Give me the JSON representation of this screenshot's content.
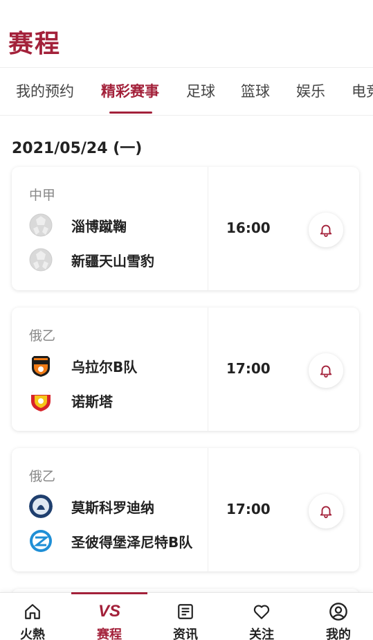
{
  "header": {
    "title": "赛程"
  },
  "tabs": [
    {
      "label": "我的预约"
    },
    {
      "label": "精彩赛事"
    },
    {
      "label": "足球"
    },
    {
      "label": "篮球"
    },
    {
      "label": "娱乐"
    },
    {
      "label": "电竞"
    }
  ],
  "active_tab": "精彩赛事",
  "date": "2021/05/24 (一)",
  "matches": [
    {
      "league": "中甲",
      "home": "淄博蹴鞠",
      "away": "新疆天山雪豹",
      "time": "16:00"
    },
    {
      "league": "俄乙",
      "home": "乌拉尔B队",
      "away": "诺斯塔",
      "time": "17:00"
    },
    {
      "league": "俄乙",
      "home": "莫斯科罗迪纳",
      "away": "圣彼得堡泽尼特B队",
      "time": "17:00"
    }
  ],
  "nav": [
    {
      "label": "火熱",
      "icon": "home-icon"
    },
    {
      "label": "赛程",
      "icon": "vs-icon",
      "icon_text": "VS"
    },
    {
      "label": "资讯",
      "icon": "news-icon"
    },
    {
      "label": "关注",
      "icon": "heart-icon"
    },
    {
      "label": "我的",
      "icon": "profile-icon"
    }
  ],
  "colors": {
    "accent": "#a3213a"
  }
}
